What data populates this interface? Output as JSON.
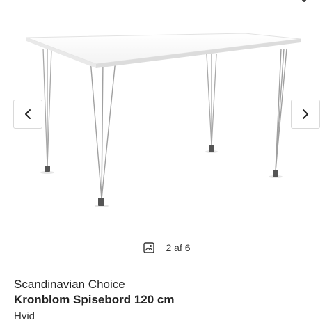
{
  "gallery": {
    "current": 2,
    "total": 6,
    "counter_text": "2 af 6"
  },
  "product": {
    "brand": "Scandinavian Choice",
    "name": "Kronblom Spisebord 120 cm",
    "variant": "Hvid"
  },
  "icons": {
    "favorite": "heart-icon",
    "previous": "chevron-left-icon",
    "next": "chevron-right-icon",
    "image": "image-icon"
  }
}
